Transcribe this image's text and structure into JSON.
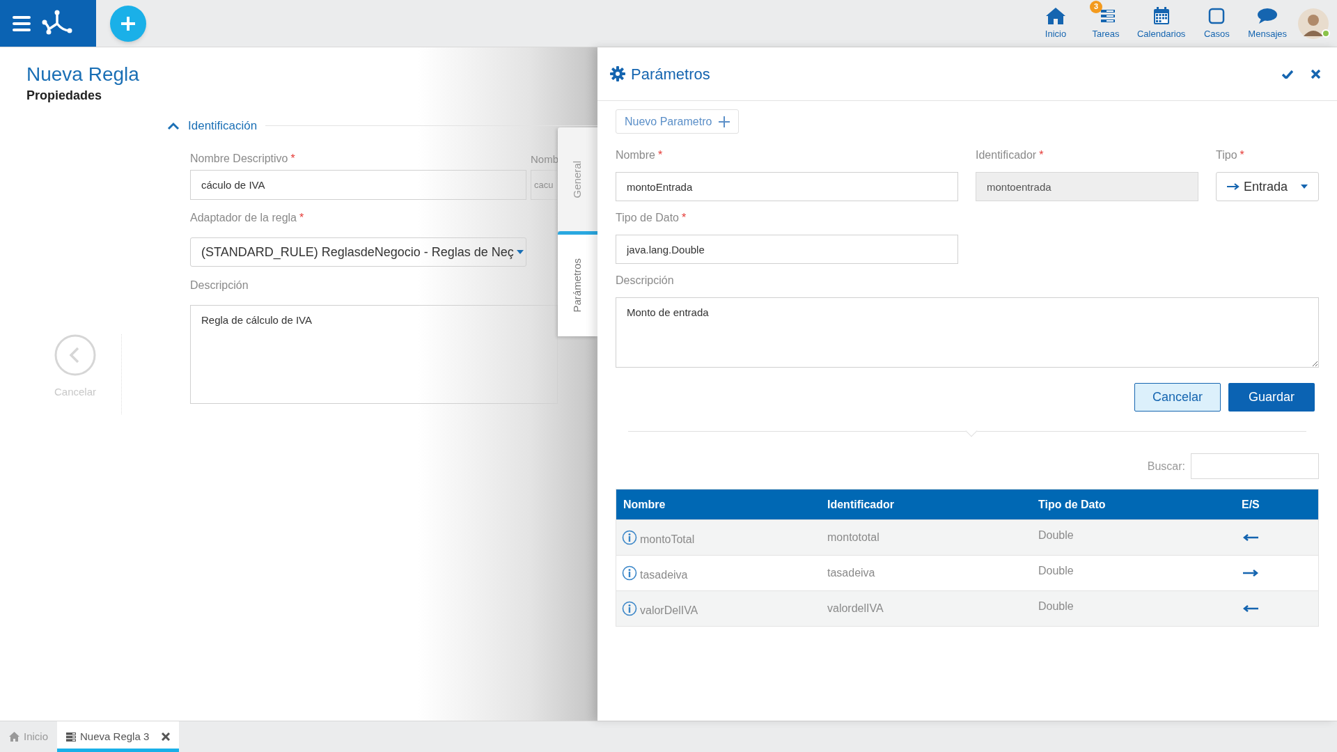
{
  "top_bar": {
    "nav": [
      {
        "kind": "home",
        "label": "Inicio"
      },
      {
        "kind": "tasks",
        "label": "Tareas",
        "badge": "3"
      },
      {
        "kind": "calendar",
        "label": "Calendarios"
      },
      {
        "kind": "cases",
        "label": "Casos"
      },
      {
        "kind": "messages",
        "label": "Mensajes"
      }
    ],
    "user": {
      "online": true
    }
  },
  "page": {
    "title": "Nueva Regla",
    "subtitle": "Propiedades",
    "section": {
      "title": "Identificación",
      "expanded": true
    },
    "nombre_descriptivo": {
      "label": "Nombre Descriptivo",
      "required_mark": "*",
      "value": "cáculo de IVA"
    },
    "hidden_nombre": {
      "label": "Nomb",
      "value": "cacu"
    },
    "adaptador": {
      "label": "Adaptador de la regla",
      "required_mark": "*",
      "value": "(STANDARD_RULE) ReglasdeNegocio - Reglas de Neç"
    },
    "descripcion": {
      "label": "Descripción",
      "value": "Regla de cálculo de IVA"
    },
    "cancel": {
      "label": "Cancelar"
    },
    "side_tabs": [
      {
        "label": "General",
        "selected": false
      },
      {
        "label": "Parámetros",
        "selected": true
      }
    ]
  },
  "panel": {
    "title": "Parámetros",
    "new_button": "Nuevo Parametro",
    "nombre": {
      "label": "Nombre",
      "required_mark": "*",
      "value": "montoEntrada"
    },
    "identificador": {
      "label": "Identificador",
      "required_mark": "*",
      "value": "montoentrada",
      "disabled": true
    },
    "tipo": {
      "label": "Tipo",
      "required_mark": "*",
      "value": "Entrada",
      "kind": "input"
    },
    "tipo_dato": {
      "label": "Tipo de Dato",
      "required_mark": "*",
      "value": "java.lang.Double"
    },
    "descripcion": {
      "label": "Descripción",
      "value": "Monto de entrada"
    },
    "buttons": [
      "Cancelar",
      "Guardar"
    ],
    "search": {
      "label": "Buscar:"
    },
    "table": {
      "columns": [
        "Nombre",
        "Identificador",
        "Tipo de Dato",
        "E/S"
      ],
      "rows": [
        {
          "nombre": "montoTotal",
          "identificador": "montototal",
          "tipo": "Double",
          "kind": "output"
        },
        {
          "nombre": "tasadeiva",
          "identificador": "tasadeiva",
          "tipo": "Double",
          "kind": "input"
        },
        {
          "nombre": "valorDelIVA",
          "identificador": "valordelIVA",
          "tipo": "Double",
          "kind": "output"
        }
      ]
    }
  },
  "bottom_tabs": [
    {
      "label": "Inicio",
      "kind": "home",
      "selected": false
    },
    {
      "label": "Nueva Regla 3",
      "kind": "rule",
      "selected": true,
      "closable": true
    }
  ]
}
